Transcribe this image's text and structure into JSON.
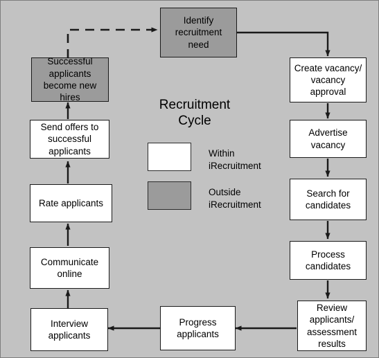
{
  "diagram": {
    "title": "Recruitment\nCycle",
    "background_color": "#c2c2c2",
    "outside_fill_color": "#9b9b9b",
    "within_fill_color": "#ffffff",
    "edge_color": "#1a1a1a"
  },
  "legend": {
    "items": [
      {
        "swatch": "white",
        "label": "Within\niRecruitment"
      },
      {
        "swatch": "gray",
        "label": "Outside\niRecruitment"
      }
    ]
  },
  "nodes": [
    {
      "id": "identify-recruitment-need",
      "label": "Identify\nrecruitment need",
      "fill": "gray"
    },
    {
      "id": "create-vacancy-approval",
      "label": "Create vacancy/\nvacancy\napproval",
      "fill": "white"
    },
    {
      "id": "advertise-vacancy",
      "label": "Advertise\nvacancy",
      "fill": "white"
    },
    {
      "id": "search-for-candidates",
      "label": "Search for\ncandidates",
      "fill": "white"
    },
    {
      "id": "process-candidates",
      "label": "Process\ncandidates",
      "fill": "white"
    },
    {
      "id": "review-applicants",
      "label": "Review\napplicants/\nassessment\nresults",
      "fill": "white"
    },
    {
      "id": "progress-applicants",
      "label": "Progress\napplicants",
      "fill": "white"
    },
    {
      "id": "interview-applicants",
      "label": "Interview\napplicants",
      "fill": "white"
    },
    {
      "id": "communicate-online",
      "label": "Communicate\nonline",
      "fill": "white"
    },
    {
      "id": "rate-applicants",
      "label": "Rate applicants",
      "fill": "white"
    },
    {
      "id": "send-offers",
      "label": "Send offers to\nsuccessful\napplicants",
      "fill": "white"
    },
    {
      "id": "successful-applicants-hires",
      "label": "Successful\napplicants\nbecome new\nhires",
      "fill": "gray"
    }
  ],
  "edges": [
    {
      "from": "identify-recruitment-need",
      "to": "create-vacancy-approval",
      "style": "solid"
    },
    {
      "from": "create-vacancy-approval",
      "to": "advertise-vacancy",
      "style": "solid"
    },
    {
      "from": "advertise-vacancy",
      "to": "search-for-candidates",
      "style": "solid"
    },
    {
      "from": "search-for-candidates",
      "to": "process-candidates",
      "style": "solid"
    },
    {
      "from": "process-candidates",
      "to": "review-applicants",
      "style": "solid"
    },
    {
      "from": "review-applicants",
      "to": "progress-applicants",
      "style": "solid"
    },
    {
      "from": "progress-applicants",
      "to": "interview-applicants",
      "style": "solid"
    },
    {
      "from": "interview-applicants",
      "to": "communicate-online",
      "style": "solid"
    },
    {
      "from": "communicate-online",
      "to": "rate-applicants",
      "style": "solid"
    },
    {
      "from": "rate-applicants",
      "to": "send-offers",
      "style": "solid"
    },
    {
      "from": "send-offers",
      "to": "successful-applicants-hires",
      "style": "solid"
    },
    {
      "from": "successful-applicants-hires",
      "to": "identify-recruitment-need",
      "style": "dashed"
    }
  ]
}
